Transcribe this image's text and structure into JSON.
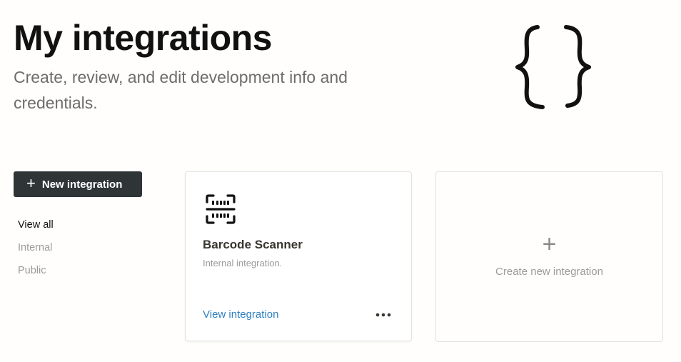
{
  "header": {
    "title": "My integrations",
    "subtitle": "Create, review, and edit development info and credentials.",
    "illustration_icon": "curly-braces-icon"
  },
  "sidebar": {
    "new_button": {
      "icon": "plus-icon",
      "label": "New integration"
    },
    "filters": [
      {
        "label": "View all",
        "active": true
      },
      {
        "label": "Internal",
        "active": false
      },
      {
        "label": "Public",
        "active": false
      }
    ]
  },
  "integrations": [
    {
      "icon": "barcode-scanner-icon",
      "name": "Barcode Scanner",
      "type": "Internal integration.",
      "link_label": "View integration",
      "menu_icon": "more-dots-icon"
    }
  ],
  "create_card": {
    "icon": "plus-icon",
    "label": "Create new integration"
  },
  "colors": {
    "background": "#fffefc",
    "button_bg": "#2f3437",
    "link": "#2e7fbf",
    "muted_text": "#9b9a97"
  }
}
